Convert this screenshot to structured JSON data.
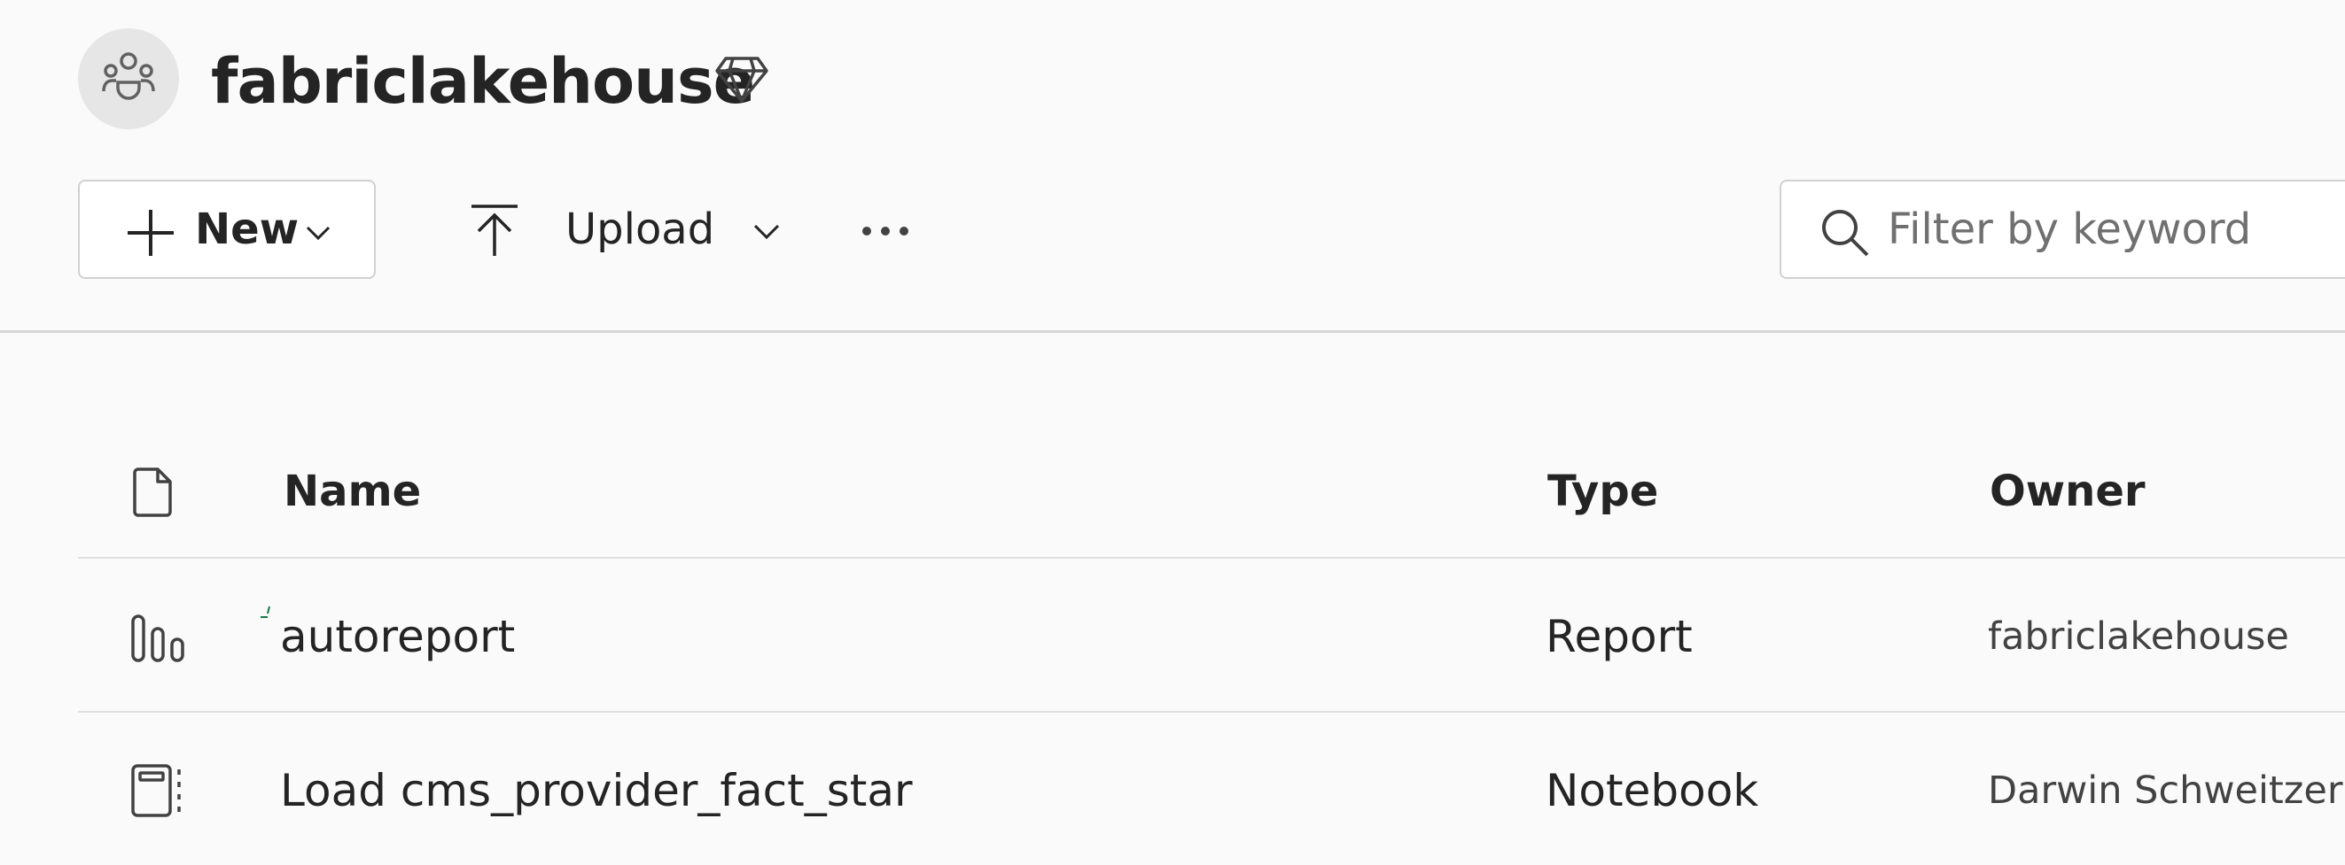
{
  "workspace": {
    "name": "fabriclakehouse",
    "avatar_icon": "people-group-icon",
    "premium_icon": "diamond-icon"
  },
  "toolbar": {
    "new_label": "New",
    "upload_label": "Upload",
    "more_icon": "ellipsis-icon"
  },
  "search": {
    "placeholder": "Filter by keyword",
    "value": ""
  },
  "table": {
    "columns": {
      "type_icon": "document-icon",
      "name": "Name",
      "type": "Type",
      "owner": "Owner"
    },
    "rows": [
      {
        "icon": "report-bar-chart-icon",
        "name": "autoreport",
        "type": "Report",
        "owner": "fabriclakehouse"
      },
      {
        "icon": "notebook-icon",
        "name": "Load cms_provider_fact_star",
        "type": "Notebook",
        "owner": "Darwin Schweitzer"
      }
    ]
  },
  "colors": {
    "background": "#fafafa",
    "text": "#242424",
    "border": "#d1d1d1",
    "avatar_bg": "#e6e6e6",
    "spinner": "#0e7a4b"
  }
}
